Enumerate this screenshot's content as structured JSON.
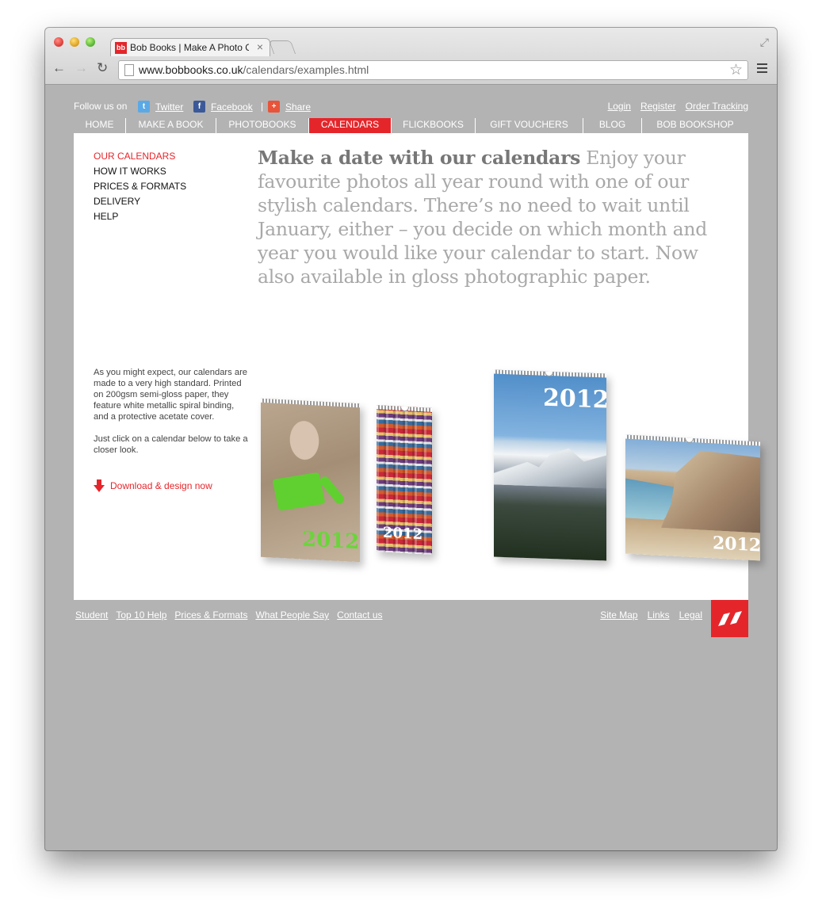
{
  "browser": {
    "tab_title": "Bob Books | Make A Photo Calendar",
    "tab_close": "×",
    "url_host": "www.bobbooks.co.uk",
    "url_path": "/calendars/examples.html",
    "back_glyph": "←",
    "forward_glyph": "→",
    "reload_glyph": "↻",
    "star_glyph": "☆",
    "resize_glyph": "⤢",
    "favicon_text": "bb"
  },
  "topbar": {
    "follow_label": "Follow us on",
    "social": [
      {
        "label": "Twitter",
        "icon": "twitter-icon",
        "color": "#5aa9e6",
        "glyph": "t"
      },
      {
        "label": "Facebook",
        "icon": "facebook-icon",
        "color": "#3b5998",
        "glyph": "f"
      },
      {
        "label": "Share",
        "icon": "share-icon",
        "color": "#e8543a",
        "glyph": "+"
      }
    ],
    "separator": "|",
    "user_links": [
      "Login",
      "Register",
      "Order Tracking"
    ]
  },
  "nav": {
    "items": [
      "HOME",
      "MAKE A BOOK",
      "PHOTOBOOKS",
      "CALENDARS",
      "FLICKBOOKS",
      "GIFT VOUCHERS",
      "BLOG",
      "BOB BOOKSHOP"
    ],
    "active": "CALENDARS",
    "accent": "#e4262b"
  },
  "sidebar": {
    "items": [
      "OUR CALENDARS",
      "HOW IT WORKS",
      "PRICES & FORMATS",
      "DELIVERY",
      "HELP"
    ],
    "active": "OUR CALENDARS"
  },
  "main": {
    "headline_bold": "Make a date with our calendars",
    "headline_rest": " Enjoy your favourite photos all year round with one of our stylish calendars. There’s no need to wait until January, either – you decide on which month and year you would like your calendar to start. Now also available in gloss photographic paper.",
    "blurb_1": "As you might expect, our calendars are made to a very high standard. Printed on 200gsm semi-gloss paper, they feature white metallic spiral binding, and a protective acetate cover.",
    "blurb_2": "Just click on a calendar below to take a closer look.",
    "download_label": "Download & design now",
    "calendars": [
      {
        "year": "2012",
        "subject": "child-in-sand"
      },
      {
        "year": "2012",
        "subject": "striped-pattern"
      },
      {
        "year": "2012",
        "subject": "snowy-mountains"
      },
      {
        "year": "2012",
        "subject": "coastal-cliffs"
      }
    ]
  },
  "footer": {
    "left_links": [
      "Student",
      "Top 10 Help",
      "Prices & Formats",
      "What People Say",
      "Contact us"
    ],
    "right_links": [
      "Site Map",
      "Links",
      "Legal"
    ]
  }
}
